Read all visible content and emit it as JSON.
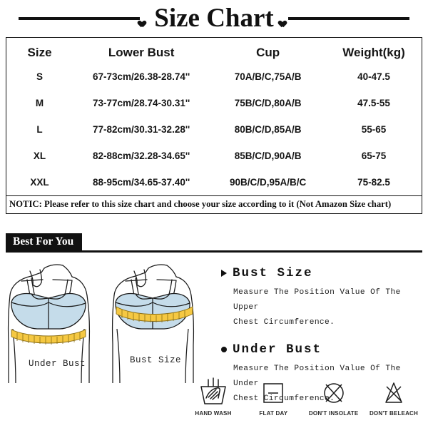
{
  "header": {
    "title": "Size Chart",
    "left_heart": "heart-icon",
    "right_heart": "heart-icon"
  },
  "size_table": {
    "columns": [
      "Size",
      "Lower Bust",
      "Cup",
      "Weight(kg)"
    ],
    "rows": [
      {
        "size": "S",
        "lower_bust": "67-73cm/26.38-28.74''",
        "cup": "70A/B/C,75A/B",
        "weight": "40-47.5"
      },
      {
        "size": "M",
        "lower_bust": "73-77cm/28.74-30.31''",
        "cup": "75B/C/D,80A/B",
        "weight": "47.5-55"
      },
      {
        "size": "L",
        "lower_bust": "77-82cm/30.31-32.28''",
        "cup": "80B/C/D,85A/B",
        "weight": "55-65"
      },
      {
        "size": "XL",
        "lower_bust": "82-88cm/32.28-34.65''",
        "cup": "85B/C/D,90A/B",
        "weight": "65-75"
      },
      {
        "size": "XXL",
        "lower_bust": "88-95cm/34.65-37.40''",
        "cup": "90B/C/D,95A/B/C",
        "weight": "75-82.5"
      }
    ],
    "notice": "NOTIC: Please refer to this size chart and choose your size according to it (Not Amazon Size chart)"
  },
  "best_for_you": {
    "badge": "Best For You"
  },
  "illustration": {
    "left_label": "Under Bust",
    "right_label": "Bust Size",
    "bra_color": "#c5dcea",
    "tape_color": "#f5c842",
    "outline_color": "#1a1a1a"
  },
  "guide": {
    "blocks": [
      {
        "title": "Bust Size",
        "bullet": "triangle-bullet-icon",
        "line1": "Measure The Position Value Of The Upper",
        "line2": "Chest Circumference."
      },
      {
        "title": "Under Bust",
        "bullet": "round-bullet-icon",
        "line1": "Measure The Position Value Of The Under",
        "line2": "Chest Circumference."
      }
    ]
  },
  "care_icons": [
    {
      "icon": "hand-wash-icon",
      "label": "HAND WASH"
    },
    {
      "icon": "flat-dry-icon",
      "label": "FLAT DAY"
    },
    {
      "icon": "no-sunlight-icon",
      "label": "DON'T INSOLATE"
    },
    {
      "icon": "no-bleach-icon",
      "label": "DON'T BELEACH"
    }
  ]
}
